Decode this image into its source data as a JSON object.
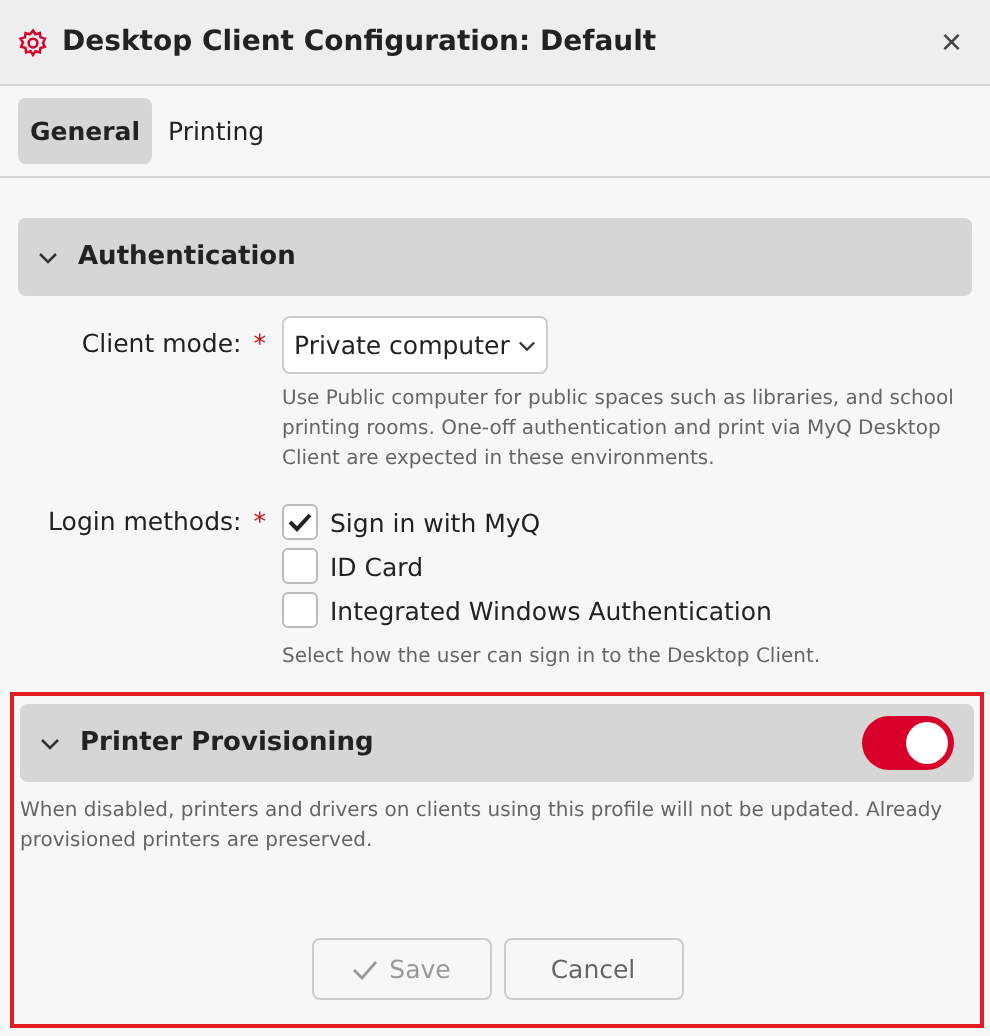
{
  "window": {
    "title": "Desktop Client Configuration: Default",
    "close": "×"
  },
  "tabs": [
    {
      "label": "General",
      "selected": true
    },
    {
      "label": "Printing",
      "selected": false
    }
  ],
  "authentication": {
    "title": "Authentication",
    "expanded": true,
    "client_mode": {
      "label": "Client mode:",
      "required": "*",
      "value": "Private computer",
      "help": "Use Public computer for public spaces such as libraries, and school printing rooms. One-off authentication and print via MyQ Desktop Client are expected in these environments."
    },
    "login_methods": {
      "label": "Login methods:",
      "required": "*",
      "options": [
        {
          "label": "Sign in with MyQ",
          "checked": true
        },
        {
          "label": "ID Card",
          "checked": false
        },
        {
          "label": "Integrated Windows Authentication",
          "checked": false
        }
      ],
      "help": "Select how the user can sign in to the Desktop Client."
    }
  },
  "printer_provisioning": {
    "title": "Printer Provisioning",
    "expanded": true,
    "on": true,
    "description": "When disabled, printers and drivers on clients using this profile will not be updated. Already provisioned printers are preserved.",
    "highlighted": true
  },
  "buttons": [
    {
      "label": "Save",
      "kind": "save",
      "disabled": true
    },
    {
      "label": "Cancel",
      "kind": "cancel",
      "disabled": false
    }
  ]
}
